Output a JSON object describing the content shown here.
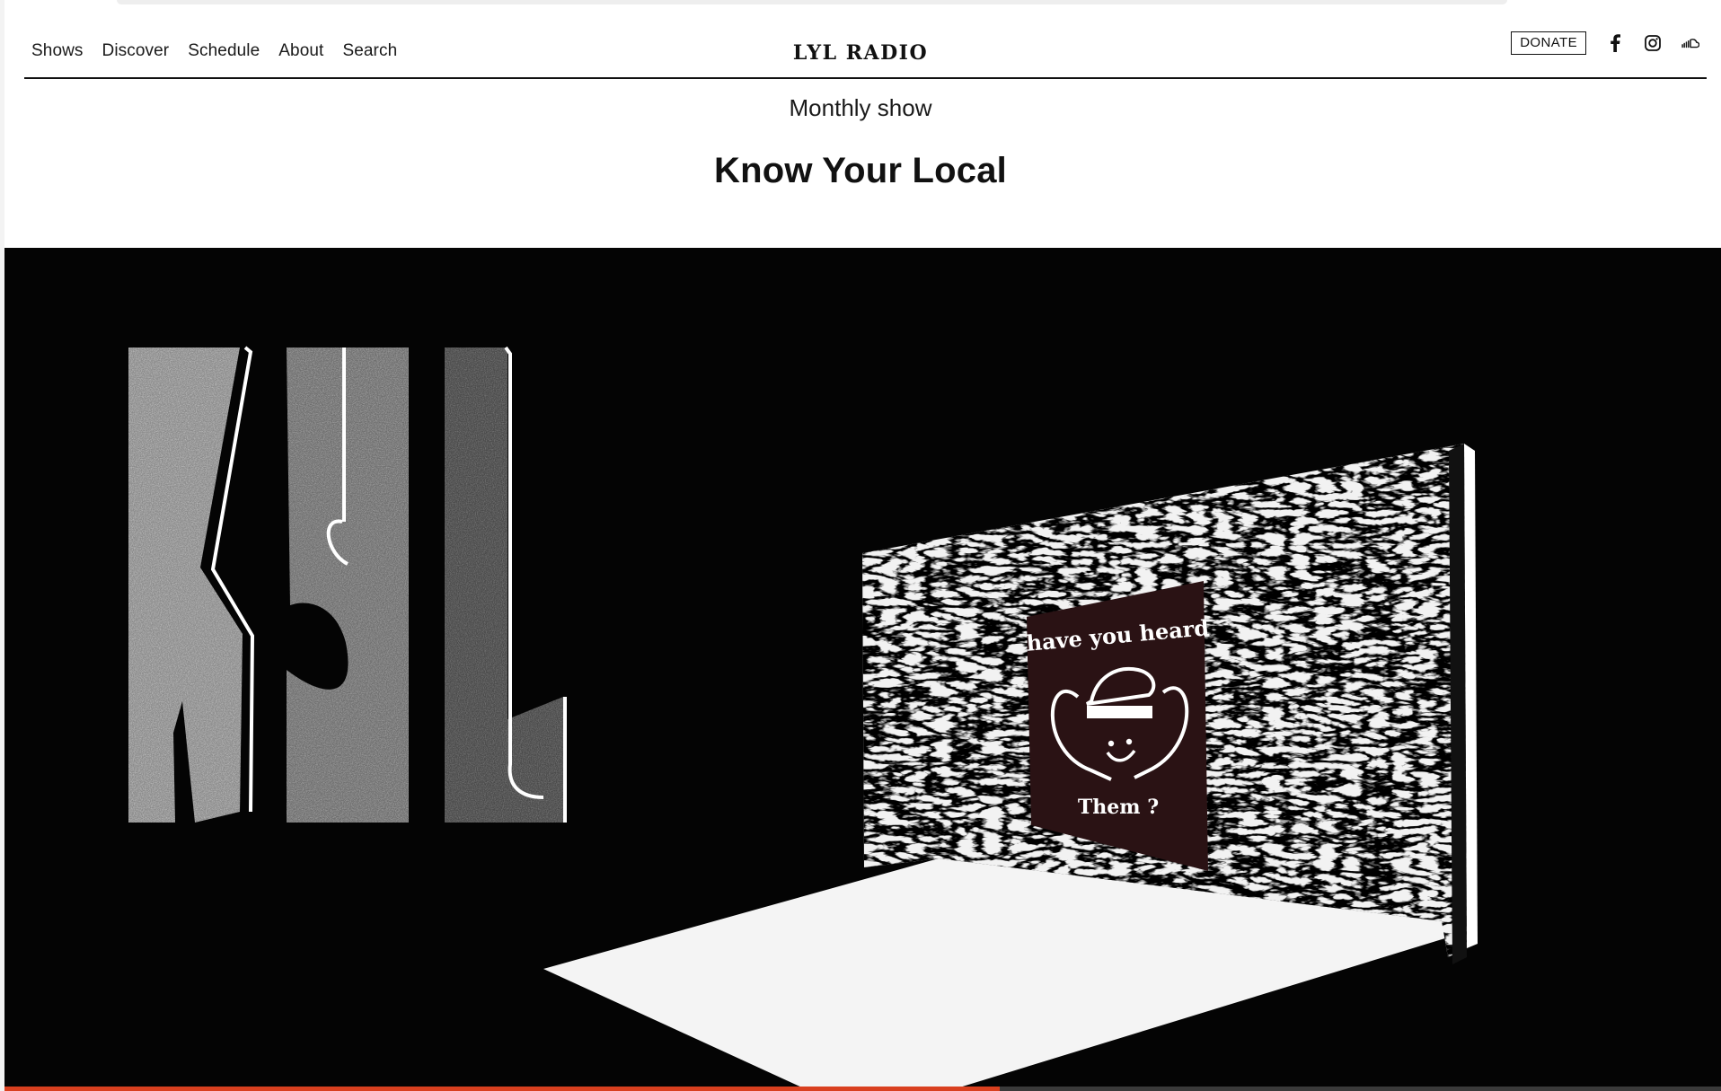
{
  "nav": {
    "links": [
      "Shows",
      "Discover",
      "Schedule",
      "About",
      "Search"
    ],
    "logo": "LYL RADIO",
    "donate_label": "DONATE",
    "social_icons": [
      "facebook-icon",
      "instagram-icon",
      "soundcloud-icon"
    ]
  },
  "show": {
    "frequency": "Monthly show",
    "title": "Know Your Local"
  },
  "artwork": {
    "letters": "KYL",
    "poster_top_text": "have you heard",
    "poster_bottom_text": "Them ?"
  },
  "player": {
    "progress": 0.58
  },
  "colors": {
    "background": "#ffffff",
    "hero_background": "#040404",
    "progress_accent": "#d9401f",
    "poster": "#2a1214"
  }
}
